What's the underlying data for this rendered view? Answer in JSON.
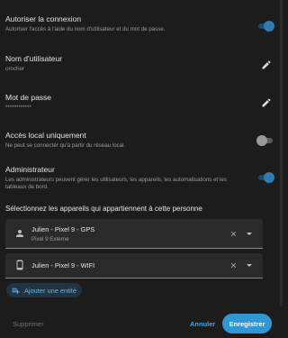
{
  "settings": {
    "allow_login": {
      "title": "Autoriser la connexion",
      "subtitle": "Autoriser l'accès à l'aide du nom d'utilisateur et du mot de passe.",
      "enabled": true
    },
    "username": {
      "title": "Nom d'utilisateur",
      "value": "orocher"
    },
    "password": {
      "title": "Mot de passe",
      "value": "************"
    },
    "local_only": {
      "title": "Accès local uniquement",
      "subtitle": "Ne peut se connecter qu'à partir du réseau local",
      "enabled": false
    },
    "admin": {
      "title": "Administrateur",
      "subtitle_line1": "Les administrateurs peuvent gérer les utilisateurs, les appareils, les automatisations et les",
      "subtitle_line2": "tableaux de bord.",
      "enabled": true
    }
  },
  "devices_section": {
    "title": "Sélectionnez les appareils qui appartiennent à cette personne",
    "devices": [
      {
        "name": "Julien - Pixel 9 - GPS",
        "subtitle": "Pixel 9 Externe",
        "icon": "person-icon"
      },
      {
        "name": "Julien - Pixel 9 - WIFI",
        "subtitle": "",
        "icon": "phone-icon"
      }
    ],
    "add_label": "Ajouter une entité"
  },
  "footer": {
    "delete_label": "Supprimer",
    "cancel_label": "Annuler",
    "save_label": "Enregistrer"
  },
  "colors": {
    "accent": "#2f97d4",
    "background": "#1c1c1c",
    "field": "#2a2a2a"
  }
}
